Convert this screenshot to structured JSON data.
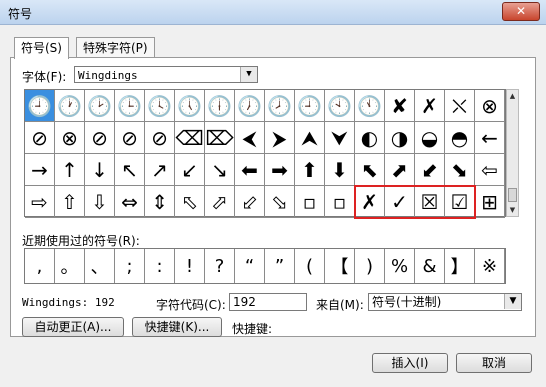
{
  "window": {
    "title": "符号",
    "close_glyph": "✕"
  },
  "tabs": [
    {
      "label": "符号(S)"
    },
    {
      "label": "特殊字符(P)"
    }
  ],
  "font": {
    "label": "字体(F):",
    "value": "Wingdings"
  },
  "symbols": [
    "🕘",
    "🕐",
    "🕑",
    "🕒",
    "🕓",
    "🕔",
    "🕕",
    "🕖",
    "🕗",
    "🕘",
    "🕙",
    "🕚",
    "✘",
    "✗",
    "⛌",
    "⊗",
    "⊘",
    "⊗",
    "⊘",
    "⊘",
    "⊘",
    "⌫",
    "⌦",
    "⮜",
    "⮞",
    "⮝",
    "⮟",
    "◐",
    "◑",
    "◒",
    "◓",
    "←",
    "→",
    "↑",
    "↓",
    "↖",
    "↗",
    "↙",
    "↘",
    "⬅",
    "➡",
    "⬆",
    "⬇",
    "⬉",
    "⬈",
    "⬋",
    "⬊",
    "⇦",
    "⇨",
    "⇧",
    "⇩",
    "⇔",
    "⇕",
    "⬁",
    "⬀",
    "⬃",
    "⬂",
    "▫",
    "▫",
    "✗",
    "✓",
    "☒",
    "☑",
    "⊞"
  ],
  "recent": {
    "label": "近期使用过的符号(R):",
    "symbols": [
      ",",
      "。",
      "、",
      ";",
      ":",
      "!",
      "?",
      "“",
      "”",
      "(",
      "【",
      ")",
      "%",
      "&",
      "】",
      "※"
    ]
  },
  "info": {
    "name": "Wingdings: 192",
    "code_label": "字符代码(C):",
    "code_value": "192",
    "from_label": "来自(M):",
    "from_value": "符号(十进制)"
  },
  "buttons": {
    "autocorrect": "自动更正(A)...",
    "shortcut_key": "快捷键(K)...",
    "shortcut_text": "快捷键:",
    "insert": "插入(I)",
    "cancel": "取消"
  }
}
